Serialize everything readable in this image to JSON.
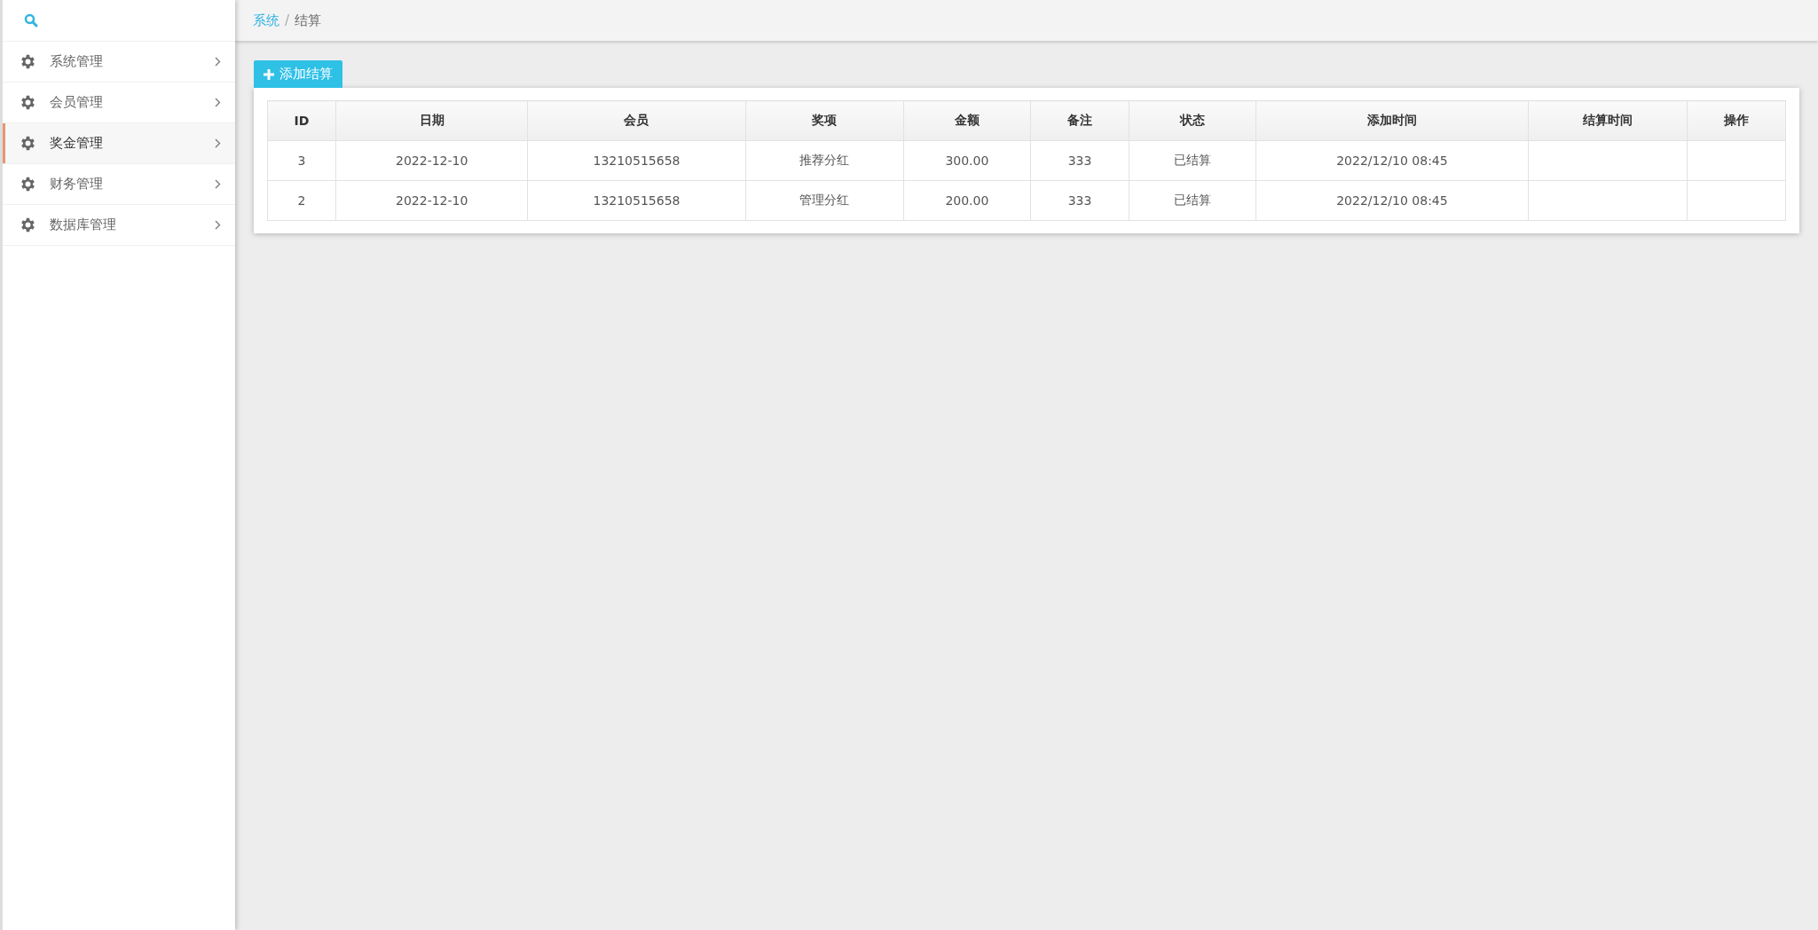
{
  "sidebar": {
    "items": [
      {
        "label": "系统管理",
        "selected": false
      },
      {
        "label": "会员管理",
        "selected": false
      },
      {
        "label": "奖金管理",
        "selected": true
      },
      {
        "label": "财务管理",
        "selected": false
      },
      {
        "label": "数据库管理",
        "selected": false
      }
    ]
  },
  "breadcrumb": {
    "separator": "/",
    "items": [
      {
        "label": "系统",
        "kind": "link"
      },
      {
        "label": "结算",
        "kind": "current"
      }
    ]
  },
  "add_button": {
    "label": "添加结算"
  },
  "table": {
    "columns": [
      "ID",
      "日期",
      "会员",
      "奖项",
      "金额",
      "备注",
      "状态",
      "添加时间",
      "结算时间",
      "操作"
    ],
    "rows": [
      [
        "3",
        "2022-12-10",
        "13210515658",
        "推荐分红",
        "300.00",
        "333",
        "已结算",
        "2022/12/10 08:45",
        "",
        ""
      ],
      [
        "2",
        "2022-12-10",
        "13210515658",
        "管理分红",
        "200.00",
        "333",
        "已结算",
        "2022/12/10 08:45",
        "",
        ""
      ]
    ]
  }
}
